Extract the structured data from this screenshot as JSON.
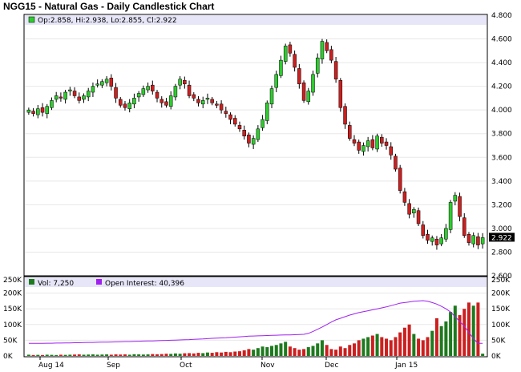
{
  "chart_data": [
    {
      "type": "candlestick",
      "title": "NGG15 - Natural Gas - Daily Candlestick Chart",
      "ohlc_readout": "Op:2.858, Hi:2.938, Lo:2.855, Cl:2.922",
      "last_price_label": "2.922",
      "ylim": [
        2.6,
        4.8
      ],
      "y_ticks": [
        "4.800",
        "4.600",
        "4.400",
        "4.200",
        "4.000",
        "3.800",
        "3.600",
        "3.400",
        "3.200",
        "3.000",
        "2.800",
        "2.600"
      ],
      "x_ticks": [
        "Aug 14",
        "Sep",
        "Oct",
        "Nov",
        "Dec",
        "Jan 15"
      ],
      "colors": {
        "up": "#2ecc2e",
        "down": "#cc1f1f",
        "wick": "#000000"
      },
      "closes": [
        4.0,
        3.97,
        4.01,
        3.98,
        4.03,
        4.08,
        4.12,
        4.1,
        4.15,
        4.17,
        4.12,
        4.08,
        4.12,
        4.16,
        4.2,
        4.22,
        4.24,
        4.26,
        4.2,
        4.1,
        4.04,
        4.02,
        4.06,
        4.1,
        4.14,
        4.18,
        4.2,
        4.16,
        4.1,
        4.06,
        4.04,
        4.12,
        4.2,
        4.26,
        4.22,
        4.12,
        4.1,
        4.06,
        4.08,
        4.1,
        4.06,
        4.04,
        4.0,
        3.97,
        3.92,
        3.88,
        3.84,
        3.78,
        3.72,
        3.76,
        3.84,
        3.92,
        4.06,
        4.18,
        4.3,
        4.42,
        4.54,
        4.48,
        4.36,
        4.22,
        4.08,
        4.16,
        4.3,
        4.44,
        4.58,
        4.5,
        4.42,
        4.26,
        4.02,
        3.88,
        3.76,
        3.72,
        3.66,
        3.7,
        3.74,
        3.68,
        3.78,
        3.72,
        3.7,
        3.62,
        3.5,
        3.32,
        3.22,
        3.12,
        3.16,
        3.04,
        2.94,
        2.9,
        2.92,
        2.86,
        2.92,
        3.0,
        3.22,
        3.28,
        3.1,
        2.94,
        2.88,
        2.94,
        2.86,
        2.922
      ]
    },
    {
      "type": "bar",
      "legend_volume": "Vol: 7,250",
      "legend_open_interest": "Open Interest: 40,396",
      "ylim": [
        0,
        250000
      ],
      "y_ticks": [
        "250K",
        "200K",
        "150K",
        "100K",
        "50K",
        "0K"
      ],
      "colors": {
        "volume_up": "#1e7a1e",
        "volume_down": "#cc1f1f",
        "open_interest": "#a020f0"
      },
      "volume": [
        4000,
        3000,
        3500,
        3000,
        4000,
        3500,
        3000,
        4000,
        3500,
        4000,
        4500,
        5000,
        4000,
        4500,
        5000,
        4000,
        4500,
        5000,
        4000,
        5000,
        4500,
        5000,
        4000,
        5500,
        5000,
        4500,
        5000,
        6000,
        5500,
        6000,
        7000,
        6500,
        8000,
        7000,
        8500,
        9000,
        8000,
        10000,
        9000,
        11000,
        10000,
        12000,
        11000,
        13000,
        12000,
        14000,
        15000,
        18000,
        22000,
        20000,
        25000,
        30000,
        28000,
        32000,
        35000,
        40000,
        45000,
        30000,
        25000,
        20000,
        22000,
        28000,
        32000,
        40000,
        50000,
        35000,
        22000,
        20000,
        30000,
        25000,
        35000,
        40000,
        50000,
        55000,
        60000,
        65000,
        70000,
        60000,
        55000,
        50000,
        60000,
        75000,
        90000,
        100000,
        70000,
        55000,
        50000,
        60000,
        80000,
        120000,
        95000,
        110000,
        140000,
        160000,
        130000,
        150000,
        170000,
        160000,
        170000,
        7250
      ],
      "open_interest": [
        40000,
        40000,
        40000,
        40000,
        40500,
        40500,
        41000,
        41000,
        41500,
        41500,
        42000,
        42000,
        42500,
        43000,
        43000,
        43500,
        44000,
        44000,
        44500,
        45000,
        45500,
        46000,
        46000,
        46500,
        47000,
        47500,
        48000,
        48000,
        48500,
        49000,
        49500,
        50000,
        50500,
        51000,
        51500,
        52000,
        53000,
        53500,
        54000,
        55000,
        56000,
        57000,
        57500,
        58000,
        59000,
        60000,
        61000,
        62000,
        63000,
        63500,
        64000,
        64500,
        65000,
        65500,
        66000,
        66500,
        67000,
        67000,
        67500,
        68000,
        69000,
        72000,
        78000,
        85000,
        92000,
        100000,
        108000,
        115000,
        120000,
        125000,
        130000,
        134000,
        138000,
        141000,
        144000,
        147000,
        150000,
        153000,
        156000,
        160000,
        164000,
        168000,
        170000,
        172000,
        174000,
        175000,
        176000,
        174000,
        170000,
        165000,
        158000,
        150000,
        140000,
        125000,
        110000,
        95000,
        75000,
        55000,
        40396,
        40396
      ]
    }
  ]
}
